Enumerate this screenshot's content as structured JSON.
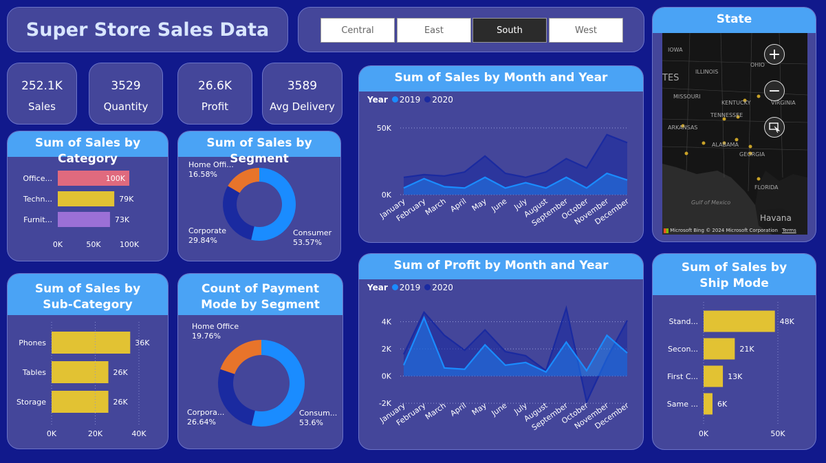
{
  "header": {
    "title": "Super Store Sales Data"
  },
  "slicer": {
    "options": [
      "Central",
      "East",
      "South",
      "West"
    ],
    "selected": "South"
  },
  "kpis": [
    {
      "value": "252.1K",
      "label": "Sales"
    },
    {
      "value": "3529",
      "label": "Quantity"
    },
    {
      "value": "26.6K",
      "label": "Profit"
    },
    {
      "value": "3589",
      "label": "Avg Delivery"
    }
  ],
  "map": {
    "title": "State",
    "labels": [
      "IOWA",
      "ILLINOIS",
      "OHIO",
      "MISSOURI",
      "KENTUCKY",
      "VIRGINIA",
      "TENNESSEE",
      "ARKANSAS",
      "ALABAMA",
      "GEORGIA",
      "FLORIDA",
      "Gulf of Mexico",
      "Havana",
      "TES",
      "© 2024 Microsoft Corporation",
      "Terms",
      "Microsoft Bing"
    ],
    "zoom_in": "+",
    "zoom_out": "−"
  },
  "colors": {
    "background": "#11198c",
    "panel": "#44469a",
    "header": "#4aa3f5",
    "y2019": "#1a8cff",
    "y2020": "#1a2aa0",
    "orange": "#e8742a",
    "yellow": "#e2c233",
    "pink": "#e06a7e",
    "purple": "#9b70d6"
  },
  "chart_data": [
    {
      "id": "category",
      "type": "bar",
      "title": "Sum of Sales by Category",
      "categories": [
        "Office...",
        "Techn...",
        "Furnit..."
      ],
      "values": [
        100,
        79,
        73
      ],
      "data_labels": [
        "100K",
        "79K",
        "73K"
      ],
      "bar_colors": [
        "#e06a7e",
        "#e2c233",
        "#9b70d6"
      ],
      "xticks": [
        "0K",
        "50K",
        "100K"
      ],
      "xlim": [
        0,
        100
      ]
    },
    {
      "id": "segment",
      "type": "pie",
      "title": "Sum of Sales by Segment",
      "labels": [
        "Consumer",
        "Corporate",
        "Home Offi..."
      ],
      "values": [
        53.57,
        29.84,
        16.58
      ],
      "pct_labels": [
        "53.57%",
        "29.84%",
        "16.58%"
      ],
      "colors": [
        "#1a8cff",
        "#1a2aa0",
        "#e8742a"
      ]
    },
    {
      "id": "subcategory",
      "type": "bar",
      "title": "Sum of Sales by Sub-Category",
      "categories": [
        "Phones",
        "Tables",
        "Storage"
      ],
      "values": [
        36,
        26,
        26
      ],
      "data_labels": [
        "36K",
        "26K",
        "26K"
      ],
      "xticks": [
        "0K",
        "20K",
        "40K"
      ],
      "xlim": [
        0,
        40
      ]
    },
    {
      "id": "payment",
      "type": "pie",
      "title": "Count of Payment Mode by Segment",
      "labels": [
        "Consum...",
        "Corpora...",
        "Home Office"
      ],
      "values": [
        53.6,
        26.64,
        19.76
      ],
      "pct_labels": [
        "53.6%",
        "26.64%",
        "19.76%"
      ],
      "colors": [
        "#1a8cff",
        "#1a2aa0",
        "#e8742a"
      ]
    },
    {
      "id": "sales_month",
      "type": "area",
      "title": "Sum of Sales by Month and Year",
      "legend_title": "Year",
      "x": [
        "January",
        "February",
        "March",
        "April",
        "May",
        "June",
        "July",
        "August",
        "September",
        "October",
        "November",
        "December"
      ],
      "series": [
        {
          "name": "2019",
          "values": [
            5,
            12,
            6,
            5,
            13,
            5,
            9,
            5,
            13,
            5,
            16,
            11
          ]
        },
        {
          "name": "2020",
          "values": [
            13,
            15,
            14,
            17,
            29,
            16,
            13,
            17,
            27,
            20,
            45,
            39
          ]
        }
      ],
      "ylim": [
        0,
        50
      ],
      "yticks": [
        "0K",
        "50K"
      ]
    },
    {
      "id": "profit_month",
      "type": "area",
      "title": "Sum of Profit by Month and Year",
      "legend_title": "Year",
      "x": [
        "January",
        "February",
        "March",
        "April",
        "May",
        "June",
        "July",
        "August",
        "September",
        "October",
        "November",
        "December"
      ],
      "series": [
        {
          "name": "2019",
          "values": [
            0.8,
            4.3,
            0.6,
            0.5,
            2.3,
            0.8,
            1.0,
            0.3,
            2.5,
            0.4,
            3.0,
            1.7
          ]
        },
        {
          "name": "2020",
          "values": [
            1.6,
            4.7,
            3.0,
            1.9,
            3.4,
            1.8,
            1.5,
            0.4,
            5.0,
            -1.9,
            1.3,
            4.1
          ]
        }
      ],
      "ylim": [
        -2.4,
        5.2
      ],
      "yticks": [
        "4K",
        "2K",
        "0K",
        "-2K"
      ],
      "ytick_values": [
        4,
        2,
        0,
        -2
      ]
    },
    {
      "id": "shipmode",
      "type": "bar",
      "title": "Sum of Sales by Ship Mode",
      "categories": [
        "Stand...",
        "Secon...",
        "First C...",
        "Same ..."
      ],
      "values": [
        48,
        21,
        13,
        6
      ],
      "data_labels": [
        "48K",
        "21K",
        "13K",
        "6K"
      ],
      "xticks": [
        "0K",
        "50K"
      ],
      "xlim": [
        0,
        50
      ]
    }
  ]
}
